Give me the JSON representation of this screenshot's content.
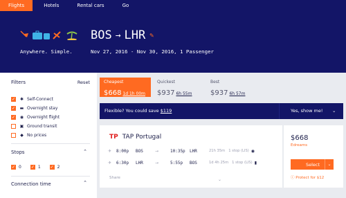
{
  "nav": {
    "items": [
      {
        "label": "Flights",
        "active": true
      },
      {
        "label": "Hotels",
        "active": false
      },
      {
        "label": "Rental cars",
        "active": false
      },
      {
        "label": "Go",
        "active": false
      }
    ]
  },
  "hero": {
    "origin": "BOS",
    "destination": "LHR",
    "tagline": "Anywhere. Simple.",
    "trip_details": "Nov 27, 2016 - Nov 30, 2016, 1 Passenger"
  },
  "filters": {
    "title": "Filters",
    "reset": "Reset",
    "options": [
      {
        "label": "Self-Connect",
        "checked": true,
        "icon": "self-connect-icon",
        "glyph": "✱"
      },
      {
        "label": "Overnight stay",
        "checked": true,
        "icon": "bed-icon",
        "glyph": "▬"
      },
      {
        "label": "Overnight flight",
        "checked": true,
        "icon": "eye-icon",
        "glyph": "◉"
      },
      {
        "label": "Ground transit",
        "checked": false,
        "icon": "bus-icon",
        "glyph": "▣"
      },
      {
        "label": "No prices",
        "checked": false,
        "icon": "tag-icon",
        "glyph": "◆"
      }
    ],
    "stops_title": "Stops",
    "stops": [
      {
        "label": "0",
        "checked": true
      },
      {
        "label": "1",
        "checked": true
      },
      {
        "label": "2",
        "checked": true
      }
    ],
    "connection_title": "Connection time"
  },
  "sort_tabs": [
    {
      "title": "Cheapest",
      "price": "$668",
      "duration": "1d 1h 00m",
      "active": true
    },
    {
      "title": "Quickest",
      "price": "$937",
      "duration": "6h 55m",
      "active": false
    },
    {
      "title": "Best",
      "price": "$937",
      "duration": "6h 57m",
      "active": false
    }
  ],
  "flex_banner": {
    "message": "Flexible? You could save",
    "amount": "$119",
    "cta": "Yes, show me!"
  },
  "result": {
    "airline": "TAP Portugal",
    "legs": [
      {
        "depart_time": "8:00p",
        "from": "BOS",
        "arrive_time": "10:35p",
        "to": "LHR",
        "duration": "21h 35m",
        "stops": "1 stop (LIS)",
        "icon": "eye-icon",
        "glyph": "◉"
      },
      {
        "depart_time": "6:30p",
        "from": "LHR",
        "arrive_time": "5:55p",
        "to": "BOS",
        "duration": "1d 4h 25m",
        "stops": "1 stop (LIS)",
        "icon": "building-icon",
        "glyph": "▮"
      }
    ],
    "share": "Share",
    "price": "$668",
    "provider": "Edreams",
    "select": "Select",
    "protect": "Protect for $12"
  },
  "colors": {
    "navy": "#131567",
    "orange": "#ff6a21"
  }
}
